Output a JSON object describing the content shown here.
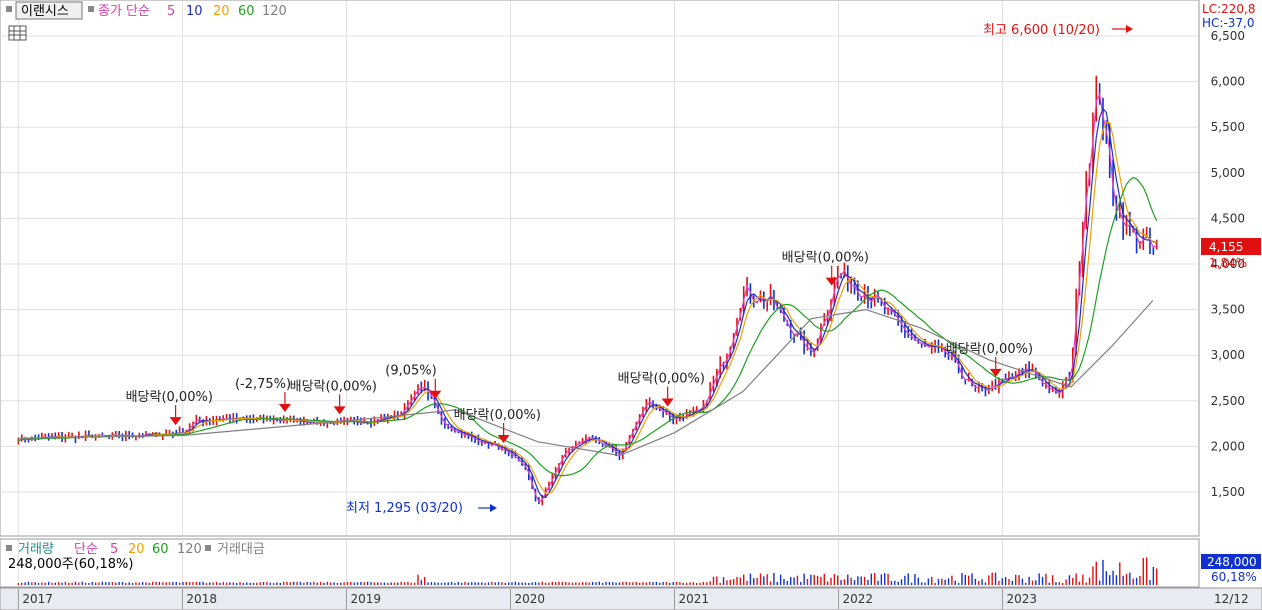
{
  "legend": {
    "stock_name": "이랜시스",
    "ma_label": "종가 단순",
    "ma_periods": [
      "5",
      "10",
      "20",
      "60",
      "120"
    ]
  },
  "volume_legend": {
    "title": "거래량",
    "ma_label": "단순",
    "ma_periods": [
      "5",
      "20",
      "60",
      "120"
    ],
    "amount_label": "거래대금",
    "current_text": "248,000주(60,18%)"
  },
  "right_labels": {
    "lc": "LC:220,8",
    "hc": "HC:-37,0",
    "price_badge": "4,155",
    "change_pct": "1,84%",
    "volume_badge": "248,000",
    "volume_pct": "60,18%",
    "last_date": "12/12"
  },
  "annotations": {
    "high": "최고 6,600 (10/20)",
    "low": "최저 1,295 (03/20)",
    "markers": [
      {
        "text": "배당락(0,00%)",
        "date": "2017-12"
      },
      {
        "text": "(-2,75%)",
        "date": "2018-08"
      },
      {
        "text": "배당락(0,00%)",
        "date": "2018-12"
      },
      {
        "text": "(9,05%)",
        "date": "2019-07"
      },
      {
        "text": "배당락(0,00%)",
        "date": "2019-12"
      },
      {
        "text": "배당락(0,00%)",
        "date": "2020-12"
      },
      {
        "text": "배당락(0,00%)",
        "date": "2021-12"
      },
      {
        "text": "배당락(0,00%)",
        "date": "2022-12"
      }
    ]
  },
  "colors": {
    "up": "#e01010",
    "down": "#1030d0",
    "ma5": "#e040c0",
    "ma10": "#2030c0",
    "ma20": "#f0a000",
    "ma60": "#20a020",
    "ma120": "#808080",
    "grid": "#e0e0e0"
  },
  "chart_data": {
    "type": "line",
    "title": "이랜시스",
    "x_axis_labels": [
      "2017",
      "2018",
      "2019",
      "2020",
      "2021",
      "2022",
      "2023",
      "12/12"
    ],
    "y_tick_labels": [
      "1,500",
      "2,000",
      "2,500",
      "3,000",
      "3,500",
      "4,000",
      "4,500",
      "5,000",
      "5,500",
      "6,000",
      "6,500"
    ],
    "ylim": [
      1000,
      6600
    ],
    "series": [
      {
        "name": "종가",
        "points": [
          [
            "2017-01",
            2080
          ],
          [
            "2017-04",
            2100
          ],
          [
            "2017-07",
            2110
          ],
          [
            "2017-10",
            2120
          ],
          [
            "2018-01",
            2150
          ],
          [
            "2018-02",
            2280
          ],
          [
            "2018-04",
            2300
          ],
          [
            "2018-07",
            2300
          ],
          [
            "2018-10",
            2280
          ],
          [
            "2018-12",
            2260
          ],
          [
            "2019-03",
            2280
          ],
          [
            "2019-05",
            2350
          ],
          [
            "2019-06",
            2600
          ],
          [
            "2019-07",
            2620
          ],
          [
            "2019-08",
            2250
          ],
          [
            "2019-10",
            2100
          ],
          [
            "2019-12",
            2000
          ],
          [
            "2020-02",
            1800
          ],
          [
            "2020-03",
            1350
          ],
          [
            "2020-05",
            1950
          ],
          [
            "2020-07",
            2100
          ],
          [
            "2020-09",
            1900
          ],
          [
            "2020-11",
            2500
          ],
          [
            "2021-01",
            2300
          ],
          [
            "2021-03",
            2400
          ],
          [
            "2021-05",
            3100
          ],
          [
            "2021-06",
            3700
          ],
          [
            "2021-08",
            3600
          ],
          [
            "2021-10",
            3200
          ],
          [
            "2021-11",
            3000
          ],
          [
            "2022-01",
            3900
          ],
          [
            "2022-03",
            3700
          ],
          [
            "2022-05",
            3400
          ],
          [
            "2022-07",
            3100
          ],
          [
            "2022-09",
            3000
          ],
          [
            "2022-11",
            2600
          ],
          [
            "2023-01",
            2700
          ],
          [
            "2023-03",
            2850
          ],
          [
            "2023-05",
            2550
          ],
          [
            "2023-06",
            2800
          ],
          [
            "2023-07",
            4800
          ],
          [
            "2023-08",
            6000
          ],
          [
            "2023-09",
            4800
          ],
          [
            "2023-10",
            4400
          ],
          [
            "2023-12",
            4155
          ]
        ]
      },
      {
        "name": "120",
        "points": [
          [
            "2017-01",
            2090
          ],
          [
            "2018-01",
            2120
          ],
          [
            "2019-01",
            2280
          ],
          [
            "2019-09",
            2400
          ],
          [
            "2020-03",
            2050
          ],
          [
            "2020-09",
            1900
          ],
          [
            "2021-01",
            2150
          ],
          [
            "2021-06",
            2600
          ],
          [
            "2021-11",
            3400
          ],
          [
            "2022-03",
            3500
          ],
          [
            "2022-07",
            3300
          ],
          [
            "2022-12",
            2950
          ],
          [
            "2023-06",
            2650
          ],
          [
            "2023-09",
            3100
          ],
          [
            "2023-12",
            3600
          ]
        ]
      }
    ]
  }
}
